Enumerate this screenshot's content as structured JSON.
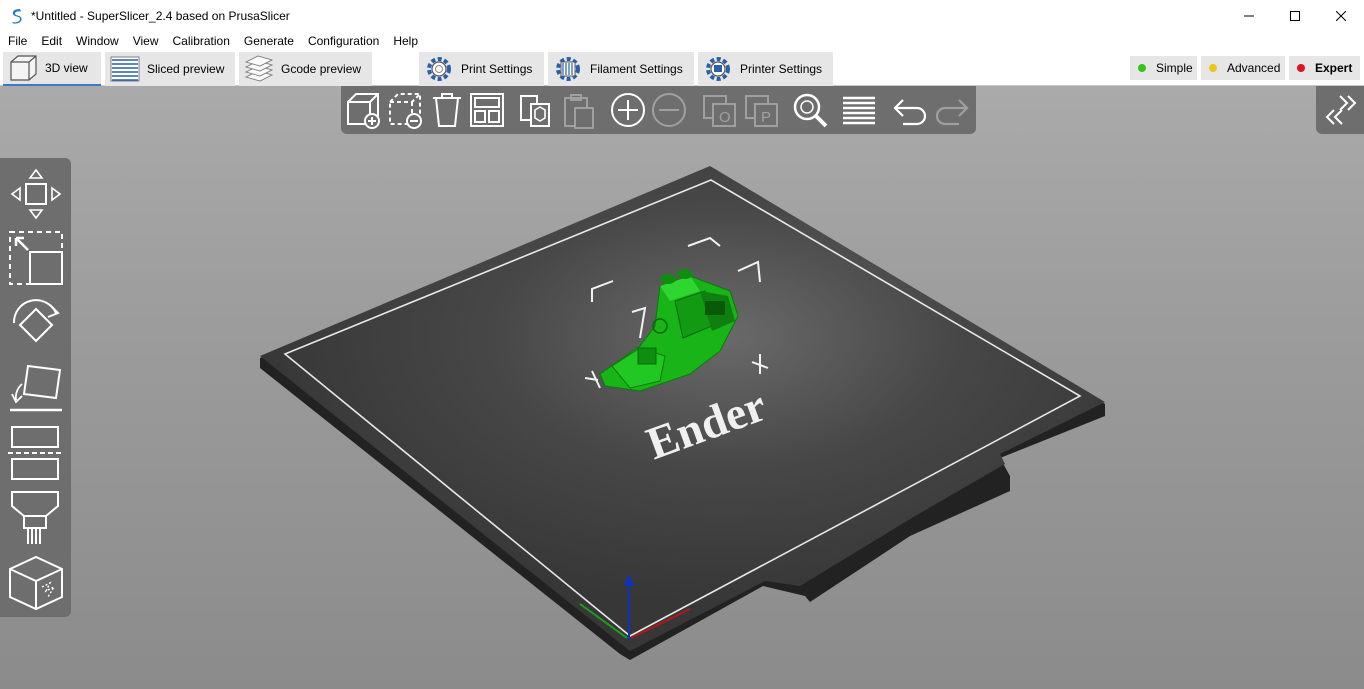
{
  "window": {
    "title": "*Untitled - SuperSlicer_2.4  based on PrusaSlicer",
    "app_icon": "superslicer-logo-icon"
  },
  "menu": [
    {
      "label": "File"
    },
    {
      "label": "Edit"
    },
    {
      "label": "Window"
    },
    {
      "label": "View"
    },
    {
      "label": "Calibration"
    },
    {
      "label": "Generate"
    },
    {
      "label": "Configuration"
    },
    {
      "label": "Help"
    }
  ],
  "tabs": {
    "view_3d": "3D view",
    "sliced_preview": "Sliced preview",
    "gcode_preview": "Gcode preview",
    "print_settings": "Print Settings",
    "filament_settings": "Filament Settings",
    "printer_settings": "Printer Settings"
  },
  "modes": {
    "simple": {
      "label": "Simple",
      "color": "#37c31a"
    },
    "advanced": {
      "label": "Advanced",
      "color": "#e8c919"
    },
    "expert": {
      "label": "Expert",
      "color": "#e0141e"
    }
  },
  "active_tab": "3D view",
  "active_mode": "Expert",
  "top_toolbar_icons": [
    "add-icon",
    "delete-icon",
    "delete-all-icon",
    "arrange-icon",
    "copy-icon",
    "paste-icon",
    "add-instance-icon",
    "remove-instance-icon",
    "split-objects-icon",
    "split-parts-icon",
    "search-icon",
    "layers-editing-icon",
    "undo-icon",
    "redo-icon"
  ],
  "left_toolbar_icons": [
    "move-icon",
    "scale-icon",
    "rotate-icon",
    "place-on-face-icon",
    "cut-icon",
    "paint-supports-icon",
    "hollow-icon"
  ],
  "scene": {
    "bed_label": "Ender",
    "model_color": "#1fc21f",
    "bed_color": "#3c3c3c"
  }
}
